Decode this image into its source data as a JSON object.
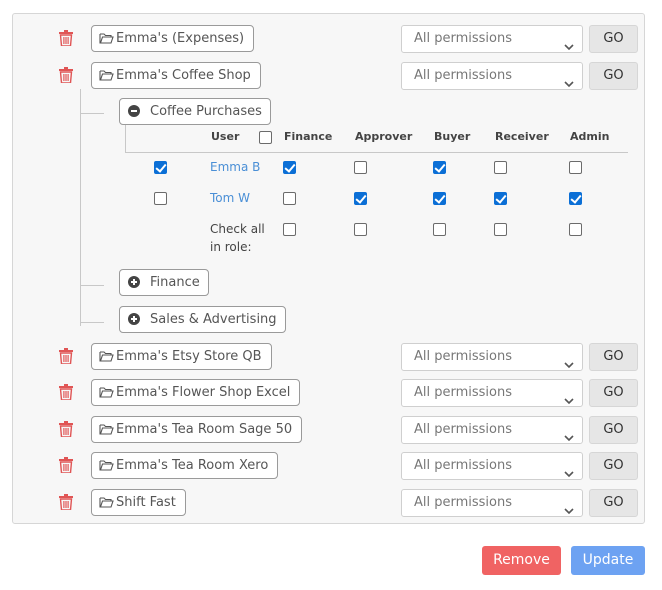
{
  "select_placeholder": "All permissions",
  "go_label": "GO",
  "companies": [
    {
      "name": "Emma's (Expenses)"
    },
    {
      "name": "Emma's Coffee Shop"
    },
    {
      "name": "Emma's Etsy Store QB"
    },
    {
      "name": "Emma's Flower Shop Excel"
    },
    {
      "name": "Emma's Tea Room Sage 50"
    },
    {
      "name": "Emma's Tea Room Xero"
    },
    {
      "name": "Shift Fast"
    }
  ],
  "roles": [
    {
      "label": "Coffee Purchases",
      "expanded": true
    },
    {
      "label": "Finance",
      "expanded": false
    },
    {
      "label": "Sales & Advertising",
      "expanded": false
    }
  ],
  "permissions_table": {
    "headers": {
      "user": "User",
      "finance": "Finance",
      "approver": "Approver",
      "buyer": "Buyer",
      "receiver": "Receiver",
      "admin": "Admin"
    },
    "rows": [
      {
        "selected": true,
        "user": "Emma B",
        "finance": true,
        "approver": false,
        "buyer": true,
        "receiver": false,
        "admin": false
      },
      {
        "selected": false,
        "user": "Tom W",
        "finance": false,
        "approver": true,
        "buyer": true,
        "receiver": true,
        "admin": true
      }
    ],
    "check_all_line1": "Check all",
    "check_all_line2": "in role:"
  },
  "actions": {
    "remove": "Remove",
    "update": "Update"
  },
  "colors": {
    "accent_blue": "#0b6fd6",
    "trash_red": "#e05555",
    "remove_red": "#f06363",
    "update_blue": "#6da2f2",
    "link_blue": "#4a8fd6"
  },
  "icons": {
    "trash": "trash-icon",
    "folder": "folder-open-icon",
    "minus": "minus-circle-icon",
    "plus": "plus-circle-icon",
    "chevron": "chevron-down-icon"
  }
}
